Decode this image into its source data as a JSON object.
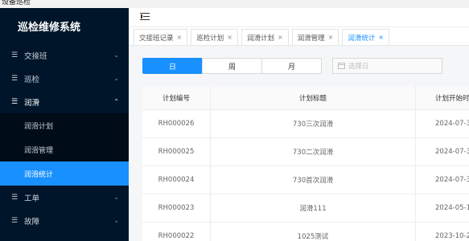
{
  "window": {
    "title": "设备巡检"
  },
  "sidebar": {
    "brand": "巡检维修系统",
    "items": [
      {
        "label": "交接班",
        "expanded": false
      },
      {
        "label": "巡检",
        "expanded": false
      },
      {
        "label": "润滑",
        "expanded": true,
        "children": [
          {
            "label": "润滑计划",
            "active": false
          },
          {
            "label": "润滑管理",
            "active": false
          },
          {
            "label": "润滑统计",
            "active": true
          }
        ]
      },
      {
        "label": "工单",
        "expanded": false
      },
      {
        "label": "故障",
        "expanded": false
      }
    ]
  },
  "tabs": [
    {
      "label": "交接班记录",
      "active": false
    },
    {
      "label": "巡检计划",
      "active": false
    },
    {
      "label": "润滑计划",
      "active": false
    },
    {
      "label": "润滑管理",
      "active": false
    },
    {
      "label": "润滑统计",
      "active": true
    }
  ],
  "filters": {
    "period_options": [
      "日",
      "周",
      "月"
    ],
    "selected_period": "日",
    "date_placeholder": "选择日"
  },
  "table": {
    "columns": [
      "计划编号",
      "计划标题",
      "计划开始时"
    ],
    "rows": [
      [
        "RH000026",
        "730三次润滑",
        "2024-07-3"
      ],
      [
        "RH000025",
        "730二次润滑",
        "2024-07-3"
      ],
      [
        "RH000024",
        "730首次润滑",
        "2024-07-3"
      ],
      [
        "RH000023",
        "润滑111",
        "2024-05-1"
      ],
      [
        "RH000022",
        "1025测试",
        "2023-10-2"
      ]
    ]
  },
  "colors": {
    "sidebar_bg": "#001529",
    "accent": "#1890ff"
  }
}
